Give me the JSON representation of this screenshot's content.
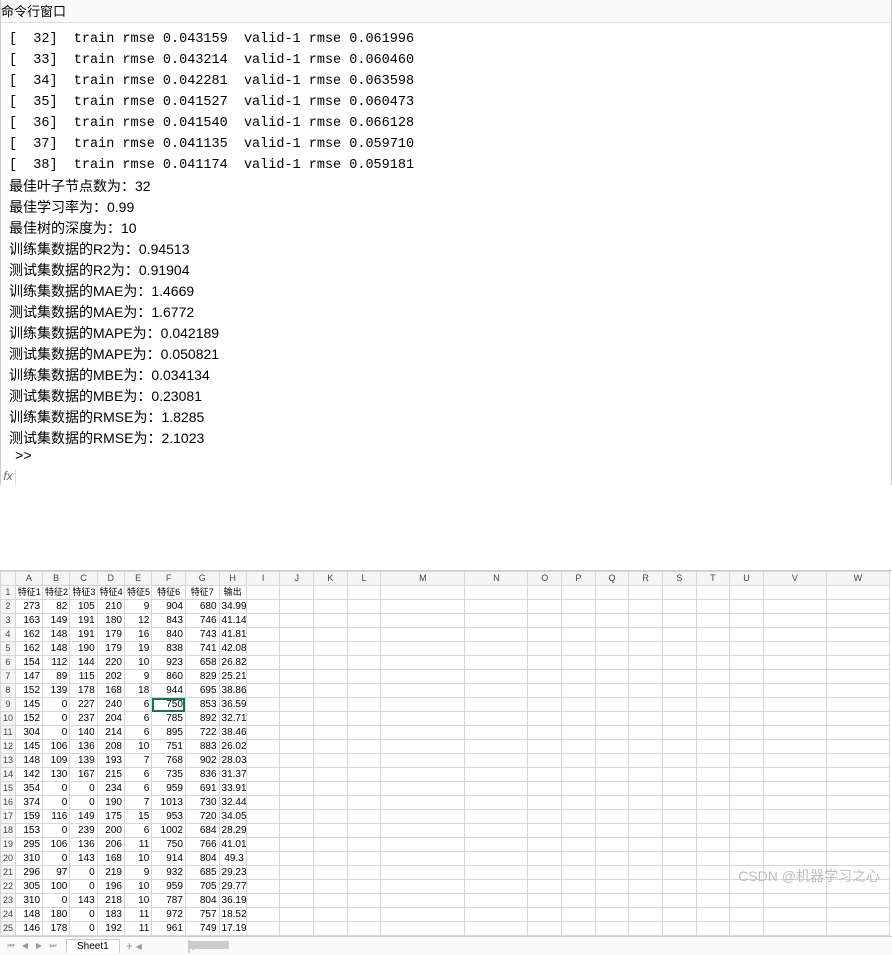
{
  "cmd": {
    "title": "命令行窗口",
    "train_lines": [
      {
        "idx": "32",
        "train": "0.043159",
        "valid": "0.061996"
      },
      {
        "idx": "33",
        "train": "0.043214",
        "valid": "0.060460"
      },
      {
        "idx": "34",
        "train": "0.042281",
        "valid": "0.063598"
      },
      {
        "idx": "35",
        "train": "0.041527",
        "valid": "0.060473"
      },
      {
        "idx": "36",
        "train": "0.041540",
        "valid": "0.066128"
      },
      {
        "idx": "37",
        "train": "0.041135",
        "valid": "0.059710"
      },
      {
        "idx": "38",
        "train": "0.041174",
        "valid": "0.059181"
      }
    ],
    "stats": [
      "最佳叶子节点数为：32",
      "最佳学习率为：0.99",
      "最佳树的深度为：10",
      "训练集数据的R2为：0.94513",
      "测试集数据的R2为：0.91904",
      "训练集数据的MAE为：1.4669",
      "测试集数据的MAE为：1.6772",
      "训练集数据的MAPE为：0.042189",
      "测试集数据的MAPE为：0.050821",
      "训练集数据的MBE为：0.034134",
      "测试集数据的MBE为：0.23081",
      "训练集数据的RMSE为：1.8285",
      "测试集数据的RMSE为：2.1023"
    ],
    "prompt": ">>",
    "fx": "fx"
  },
  "sheet": {
    "cols": [
      "",
      "A",
      "B",
      "C",
      "D",
      "E",
      "F",
      "G",
      "H",
      "I",
      "J",
      "K",
      "L",
      "M",
      "N",
      "O",
      "P",
      "Q",
      "R",
      "S",
      "T",
      "U",
      "V",
      "W"
    ],
    "header_row": [
      "特征1",
      "特征2",
      "特征3",
      "特征4",
      "特征5",
      "特征6",
      "特征7",
      "输出"
    ],
    "rows": [
      [
        "273",
        "82",
        "105",
        "210",
        "9",
        "904",
        "680",
        "34.99"
      ],
      [
        "163",
        "149",
        "191",
        "180",
        "12",
        "843",
        "746",
        "41.14"
      ],
      [
        "162",
        "148",
        "191",
        "179",
        "16",
        "840",
        "743",
        "41.81"
      ],
      [
        "162",
        "148",
        "190",
        "179",
        "19",
        "838",
        "741",
        "42.08"
      ],
      [
        "154",
        "112",
        "144",
        "220",
        "10",
        "923",
        "658",
        "26.82"
      ],
      [
        "147",
        "89",
        "115",
        "202",
        "9",
        "860",
        "829",
        "25.21"
      ],
      [
        "152",
        "139",
        "178",
        "168",
        "18",
        "944",
        "695",
        "38.86"
      ],
      [
        "145",
        "0",
        "227",
        "240",
        "6",
        "750",
        "853",
        "36.59"
      ],
      [
        "152",
        "0",
        "237",
        "204",
        "6",
        "785",
        "892",
        "32.71"
      ],
      [
        "304",
        "0",
        "140",
        "214",
        "6",
        "895",
        "722",
        "38.46"
      ],
      [
        "145",
        "106",
        "136",
        "208",
        "10",
        "751",
        "883",
        "26.02"
      ],
      [
        "148",
        "109",
        "139",
        "193",
        "7",
        "768",
        "902",
        "28.03"
      ],
      [
        "142",
        "130",
        "167",
        "215",
        "6",
        "735",
        "836",
        "31.37"
      ],
      [
        "354",
        "0",
        "0",
        "234",
        "6",
        "959",
        "691",
        "33.91"
      ],
      [
        "374",
        "0",
        "0",
        "190",
        "7",
        "1013",
        "730",
        "32.44"
      ],
      [
        "159",
        "116",
        "149",
        "175",
        "15",
        "953",
        "720",
        "34.05"
      ],
      [
        "153",
        "0",
        "239",
        "200",
        "6",
        "1002",
        "684",
        "28.29"
      ],
      [
        "295",
        "106",
        "136",
        "206",
        "11",
        "750",
        "766",
        "41.01"
      ],
      [
        "310",
        "0",
        "143",
        "168",
        "10",
        "914",
        "804",
        "49.3"
      ],
      [
        "296",
        "97",
        "0",
        "219",
        "9",
        "932",
        "685",
        "29.23"
      ],
      [
        "305",
        "100",
        "0",
        "196",
        "10",
        "959",
        "705",
        "29.77"
      ],
      [
        "310",
        "0",
        "143",
        "218",
        "10",
        "787",
        "804",
        "36.19"
      ],
      [
        "148",
        "180",
        "0",
        "183",
        "11",
        "972",
        "757",
        "18.52"
      ],
      [
        "146",
        "178",
        "0",
        "192",
        "11",
        "961",
        "749",
        "17.19"
      ]
    ],
    "selected": {
      "row": 9,
      "col": "F",
      "value": "750"
    },
    "active_tab": "Sheet1"
  },
  "watermark": "CSDN @机器学习之心"
}
